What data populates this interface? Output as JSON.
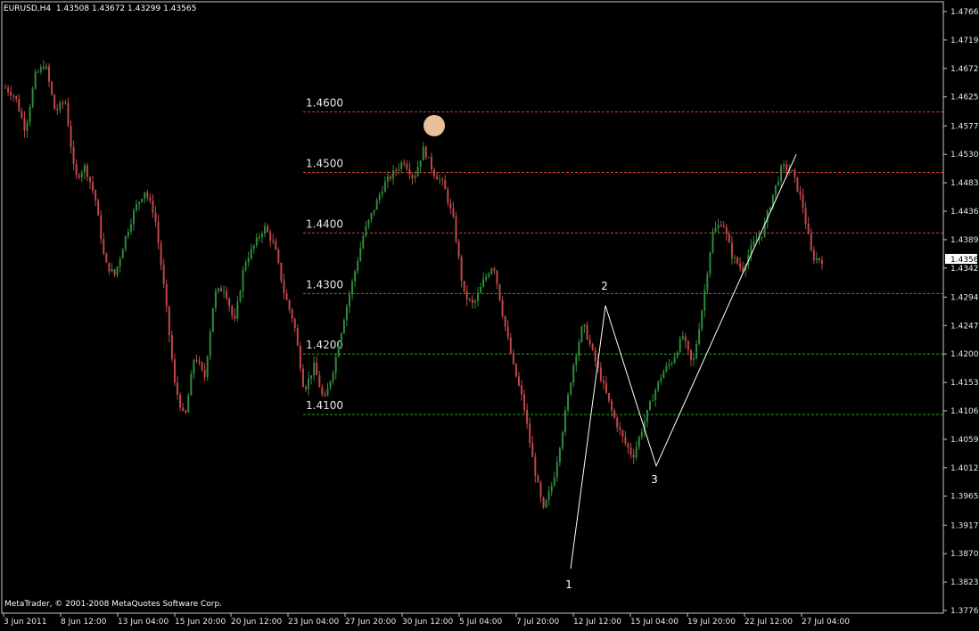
{
  "header": {
    "symbol": "EURUSD,H4",
    "ohlc": "1.43508 1.43672 1.43299 1.43565"
  },
  "footer": {
    "copyright": "MetaTrader, © 2001-2008 MetaQuotes Software Corp."
  },
  "colors": {
    "background": "#000000",
    "bull": "#2e8b3a",
    "bear": "#c0474a",
    "resistance_line": "#d04030",
    "support_line": "#2aa02a",
    "axis": "#c8c8c8",
    "wave": "#ffffff",
    "marker": "#ffd6a8"
  },
  "chart_data": {
    "type": "candlestick",
    "symbol": "EURUSD",
    "timeframe": "H4",
    "price_axis": {
      "ticks": [
        "1.47660",
        "1.47190",
        "1.46720",
        "1.46250",
        "1.45770",
        "1.45300",
        "1.44830",
        "1.44360",
        "1.43890",
        "1.43420",
        "1.42940",
        "1.42470",
        "1.42000",
        "1.41530",
        "1.41060",
        "1.40590",
        "1.40120",
        "1.39650",
        "1.39170",
        "1.38700",
        "1.38230",
        "1.37760"
      ],
      "current_price": "1.43565",
      "range": [
        1.3776,
        1.4766
      ]
    },
    "time_axis": {
      "ticks": [
        "3 Jun 2011",
        "8 Jun 12:00",
        "13 Jun 04:00",
        "15 Jun 20:00",
        "20 Jun 12:00",
        "23 Jun 04:00",
        "27 Jun 20:00",
        "30 Jun 12:00",
        "5 Jul 04:00",
        "7 Jul 20:00",
        "12 Jul 12:00",
        "15 Jul 04:00",
        "19 Jul 20:00",
        "22 Jul 12:00",
        "27 Jul 04:00"
      ]
    },
    "horizontal_levels": [
      {
        "label": "1.4600",
        "price": 1.46,
        "kind": "resistance"
      },
      {
        "label": "1.4500",
        "price": 1.45,
        "kind": "resistance"
      },
      {
        "label": "1.4400",
        "price": 1.44,
        "kind": "resistance"
      },
      {
        "label": "1.4300",
        "price": 1.43,
        "kind": "support"
      },
      {
        "label": "1.4200",
        "price": 1.42,
        "kind": "support"
      },
      {
        "label": "1.4100",
        "price": 1.41,
        "kind": "support"
      }
    ],
    "wave_labels": [
      {
        "label": "1",
        "price": 1.3845
      },
      {
        "label": "2",
        "price": 1.428
      },
      {
        "label": "3",
        "price": 1.4015
      }
    ],
    "price_path": [
      [
        1.464,
        1.4625
      ],
      [
        1.4625,
        1.457
      ],
      [
        1.457,
        1.466
      ],
      [
        1.466,
        1.468
      ],
      [
        1.468,
        1.46
      ],
      [
        1.46,
        1.462
      ],
      [
        1.462,
        1.449
      ],
      [
        1.449,
        1.451
      ],
      [
        1.451,
        1.446
      ],
      [
        1.446,
        1.435
      ],
      [
        1.435,
        1.433
      ],
      [
        1.433,
        1.439
      ],
      [
        1.439,
        1.444
      ],
      [
        1.444,
        1.447
      ],
      [
        1.447,
        1.443
      ],
      [
        1.443,
        1.43
      ],
      [
        1.43,
        1.415
      ],
      [
        1.415,
        1.409
      ],
      [
        1.409,
        1.42
      ],
      [
        1.42,
        1.416
      ],
      [
        1.416,
        1.43
      ],
      [
        1.43,
        1.431
      ],
      [
        1.431,
        1.425
      ],
      [
        1.425,
        1.435
      ],
      [
        1.435,
        1.438
      ],
      [
        1.438,
        1.441
      ],
      [
        1.441,
        1.438
      ],
      [
        1.438,
        1.43
      ],
      [
        1.43,
        1.425
      ],
      [
        1.425,
        1.414
      ],
      [
        1.414,
        1.418
      ],
      [
        1.418,
        1.412
      ],
      [
        1.412,
        1.418
      ],
      [
        1.418,
        1.426
      ],
      [
        1.426,
        1.433
      ],
      [
        1.433,
        1.44
      ],
      [
        1.44,
        1.444
      ],
      [
        1.444,
        1.448
      ],
      [
        1.448,
        1.45
      ],
      [
        1.45,
        1.452
      ],
      [
        1.452,
        1.449
      ],
      [
        1.449,
        1.454
      ],
      [
        1.454,
        1.45
      ],
      [
        1.45,
        1.448
      ],
      [
        1.448,
        1.442
      ],
      [
        1.442,
        1.43
      ],
      [
        1.43,
        1.428
      ],
      [
        1.428,
        1.432
      ],
      [
        1.432,
        1.435
      ],
      [
        1.435,
        1.426
      ],
      [
        1.426,
        1.418
      ],
      [
        1.418,
        1.412
      ],
      [
        1.412,
        1.402
      ],
      [
        1.402,
        1.394
      ],
      [
        1.394,
        1.399
      ],
      [
        1.399,
        1.408
      ],
      [
        1.408,
        1.418
      ],
      [
        1.418,
        1.425
      ],
      [
        1.425,
        1.42
      ],
      [
        1.42,
        1.415
      ],
      [
        1.415,
        1.41
      ],
      [
        1.41,
        1.406
      ],
      [
        1.406,
        1.403
      ],
      [
        1.403,
        1.408
      ],
      [
        1.408,
        1.413
      ],
      [
        1.413,
        1.417
      ],
      [
        1.417,
        1.419
      ],
      [
        1.419,
        1.423
      ],
      [
        1.423,
        1.418
      ],
      [
        1.418,
        1.428
      ],
      [
        1.428,
        1.44
      ],
      [
        1.44,
        1.442
      ],
      [
        1.442,
        1.436
      ],
      [
        1.436,
        1.434
      ],
      [
        1.434,
        1.438
      ],
      [
        1.438,
        1.44
      ],
      [
        1.44,
        1.446
      ],
      [
        1.446,
        1.451
      ],
      [
        1.451,
        1.45
      ],
      [
        1.45,
        1.445
      ],
      [
        1.445,
        1.436
      ],
      [
        1.436,
        1.4355
      ]
    ]
  }
}
